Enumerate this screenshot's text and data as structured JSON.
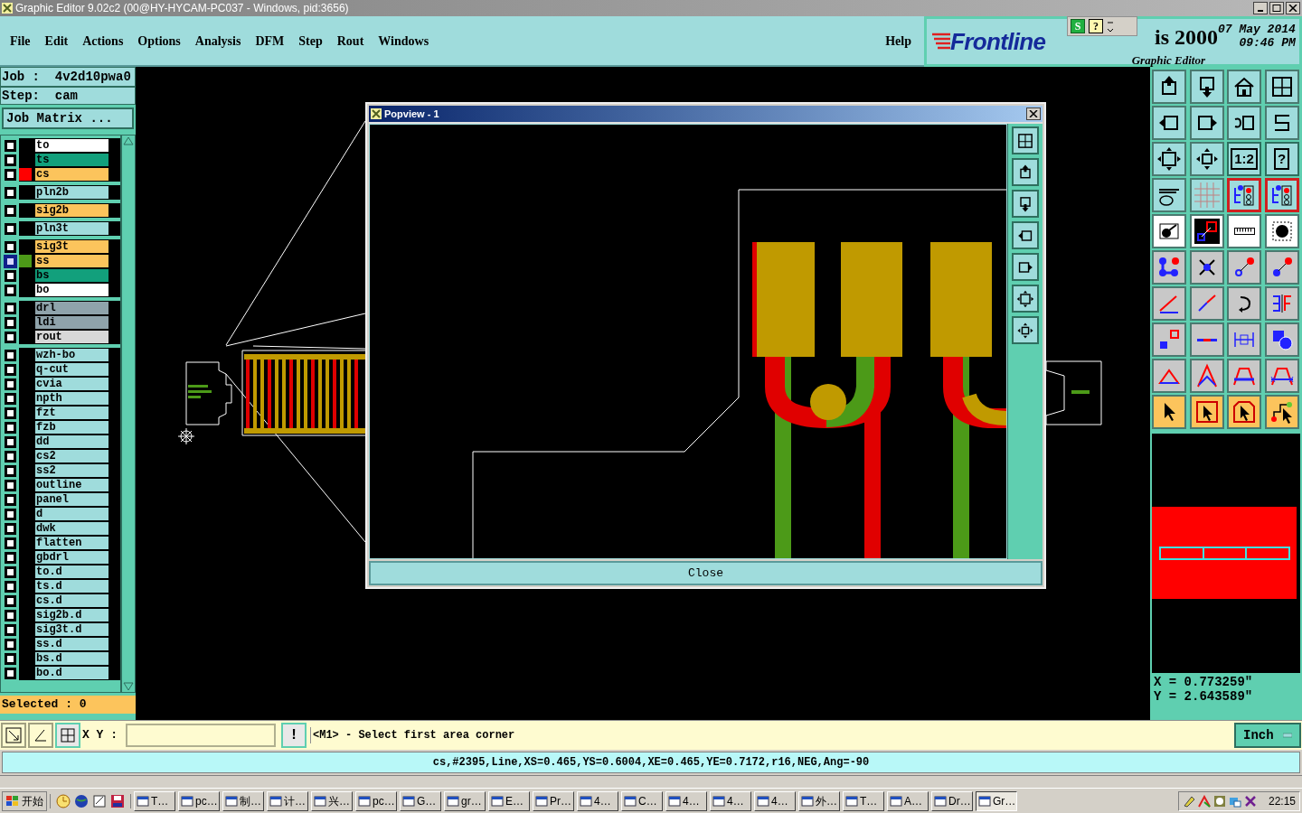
{
  "window": {
    "title": "Graphic Editor 9.02c2 (00@HY-HYCAM-PC037 - Windows, pid:3656)"
  },
  "menu": [
    "File",
    "Edit",
    "Actions",
    "Options",
    "Analysis",
    "DFM",
    "Step",
    "Rout",
    "Windows"
  ],
  "help": "Help",
  "brand": {
    "logo": "Frontline",
    "product": "is 2000",
    "subtitle": "Graphic Editor",
    "date": "07 May 2014",
    "time": "09:46 PM"
  },
  "float_toolbar": {
    "s_label": "S",
    "help": "?"
  },
  "job": {
    "job": "Job :  4v2d10pwa0",
    "step": "Step:  cam",
    "matrix_button": "Job Matrix ..."
  },
  "layer_groups": [
    [
      {
        "name": "to",
        "kind": "silk",
        "work": false
      },
      {
        "name": "ts",
        "kind": "mask",
        "work": false
      },
      {
        "name": "cs",
        "kind": "signal",
        "color": "#ff0000",
        "work": false
      }
    ],
    [
      {
        "name": "pln2b",
        "kind": "misc",
        "work": false
      }
    ],
    [
      {
        "name": "sig2b",
        "kind": "signal",
        "work": false
      }
    ],
    [
      {
        "name": "pln3t",
        "kind": "misc",
        "work": false
      }
    ],
    [
      {
        "name": "sig3t",
        "kind": "signal",
        "work": false
      },
      {
        "name": "ss",
        "kind": "signal",
        "color": "#4c9a18",
        "work": true
      },
      {
        "name": "bs",
        "kind": "mask",
        "work": false
      },
      {
        "name": "bo",
        "kind": "silk",
        "work": false
      }
    ],
    [
      {
        "name": "drl",
        "kind": "drill",
        "work": false
      },
      {
        "name": "ldi",
        "kind": "drill",
        "work": false
      },
      {
        "name": "rout",
        "kind": "rout",
        "work": false
      }
    ],
    [
      {
        "name": "wzh-bo",
        "kind": "misc",
        "work": false
      },
      {
        "name": "q-cut",
        "kind": "misc",
        "work": false
      },
      {
        "name": "cvia",
        "kind": "misc",
        "work": false
      },
      {
        "name": "npth",
        "kind": "misc",
        "work": false
      },
      {
        "name": "fzt",
        "kind": "misc",
        "work": false
      },
      {
        "name": "fzb",
        "kind": "misc",
        "work": false
      },
      {
        "name": "dd",
        "kind": "misc",
        "work": false
      },
      {
        "name": "cs2",
        "kind": "misc",
        "work": false
      },
      {
        "name": "ss2",
        "kind": "misc",
        "work": false
      },
      {
        "name": "outline",
        "kind": "misc",
        "work": false
      },
      {
        "name": "panel",
        "kind": "misc",
        "work": false
      },
      {
        "name": "d",
        "kind": "misc",
        "work": false
      },
      {
        "name": "dwk",
        "kind": "misc",
        "work": false
      },
      {
        "name": "flatten",
        "kind": "misc",
        "work": false
      },
      {
        "name": "gbdrl",
        "kind": "misc",
        "work": false
      },
      {
        "name": "to.d",
        "kind": "misc",
        "work": false
      },
      {
        "name": "ts.d",
        "kind": "misc",
        "work": false
      },
      {
        "name": "cs.d",
        "kind": "misc",
        "work": false
      },
      {
        "name": "sig2b.d",
        "kind": "misc",
        "work": false
      },
      {
        "name": "sig3t.d",
        "kind": "misc",
        "work": false
      },
      {
        "name": "ss.d",
        "kind": "misc",
        "work": false
      },
      {
        "name": "bs.d",
        "kind": "misc",
        "work": false
      },
      {
        "name": "bo.d",
        "kind": "misc",
        "work": false
      }
    ]
  ],
  "selected_count": "Selected : 0",
  "popview": {
    "title": "Popview - 1",
    "close_button": "Close"
  },
  "toolbox": {
    "scale": "1:2",
    "help": "?",
    "net_buttons": [
      {
        "on": true
      },
      {
        "on": true
      }
    ]
  },
  "coords": {
    "x": "X = 0.773259\"",
    "y": "Y = 2.643589\""
  },
  "command_bar": {
    "xy_label": "X Y :",
    "alert": "!",
    "prompt": "<M1> - Select first area corner",
    "units": "Inch"
  },
  "status_line": "cs,#2395,Line,XS=0.465,YS=0.6004,XE=0.465,YE=0.7172,r16,NEG,Ang=-90",
  "taskbar": {
    "start": "开始",
    "tasks": [
      {
        "label": "T…",
        "selected": false
      },
      {
        "label": "pc…",
        "selected": false
      },
      {
        "label": "制…",
        "selected": false
      },
      {
        "label": "计…",
        "selected": false
      },
      {
        "label": "兴…",
        "selected": false
      },
      {
        "label": "pc…",
        "selected": false
      },
      {
        "label": "G…",
        "selected": false
      },
      {
        "label": "gr…",
        "selected": false
      },
      {
        "label": "E…",
        "selected": false
      },
      {
        "label": "Pr…",
        "selected": false
      },
      {
        "label": "4…",
        "selected": false
      },
      {
        "label": "C…",
        "selected": false
      },
      {
        "label": "4…",
        "selected": false
      },
      {
        "label": "4…",
        "selected": false
      },
      {
        "label": "4…",
        "selected": false
      },
      {
        "label": "外…",
        "selected": false
      },
      {
        "label": "T…",
        "selected": false
      },
      {
        "label": "A…",
        "selected": false
      },
      {
        "label": "Dr…",
        "selected": false
      },
      {
        "label": "Gr…",
        "selected": true
      }
    ],
    "clock": "22:15"
  }
}
